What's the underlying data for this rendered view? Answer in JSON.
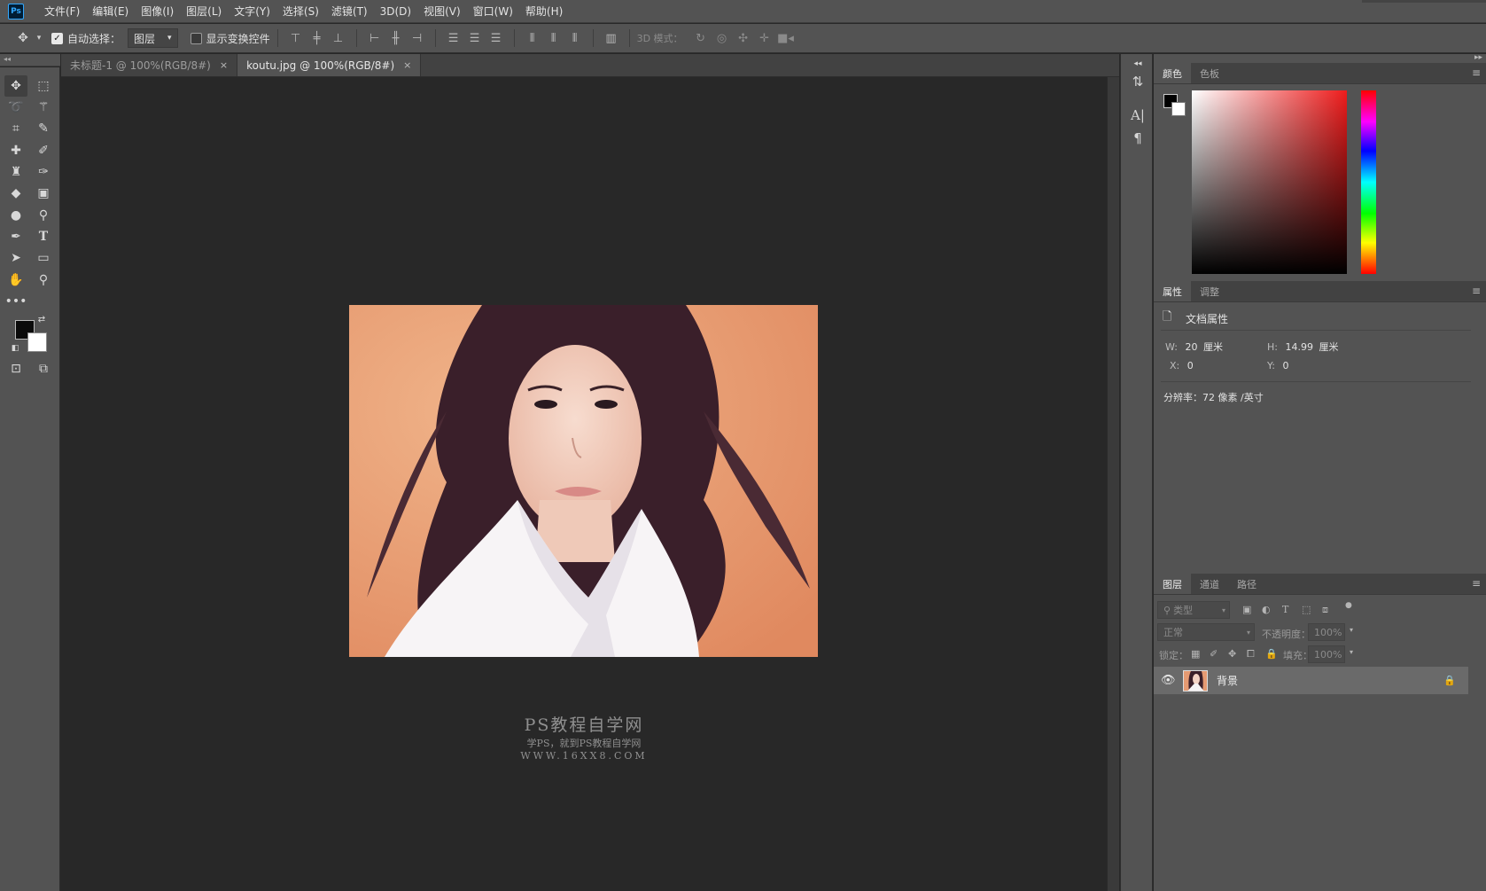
{
  "menubar": {
    "logo": "Ps",
    "items": [
      "文件(F)",
      "编辑(E)",
      "图像(I)",
      "图层(L)",
      "文字(Y)",
      "选择(S)",
      "滤镜(T)",
      "3D(D)",
      "视图(V)",
      "窗口(W)",
      "帮助(H)"
    ]
  },
  "options": {
    "auto_select_label": "自动选择：",
    "auto_select_value": "图层",
    "show_transform_label": "显示变换控件",
    "mode_3d_label": "3D 模式："
  },
  "tabs": [
    {
      "label": "未标题-1 @ 100%(RGB/8#)",
      "close": "×"
    },
    {
      "label": "koutu.jpg @ 100%(RGB/8#)",
      "close": "×"
    }
  ],
  "watermark": {
    "line1": "PS教程自学网",
    "line2": "学PS，就到PS教程自学网",
    "line3": "WWW.16XX8.COM"
  },
  "color_panel": {
    "tabs": [
      "颜色",
      "色板"
    ]
  },
  "properties_panel": {
    "tabs": [
      "属性",
      "调整"
    ],
    "header": "文档属性",
    "w_label": "W:",
    "w_value": "20",
    "w_unit": "厘米",
    "h_label": "H:",
    "h_value": "14.99",
    "h_unit": "厘米",
    "x_label": "X:",
    "x_value": "0",
    "y_label": "Y:",
    "y_value": "0",
    "resolution": "分辨率：72 像素 /英寸"
  },
  "layers_panel": {
    "tabs": [
      "图层",
      "通道",
      "路径"
    ],
    "filter_placeholder": "类型",
    "blend_mode": "正常",
    "opacity_label": "不透明度：",
    "opacity_value": "100%",
    "lock_label": "锁定：",
    "fill_label": "填充：",
    "fill_value": "100%",
    "layers": [
      {
        "name": "背景",
        "visible": true,
        "locked": true
      }
    ]
  }
}
